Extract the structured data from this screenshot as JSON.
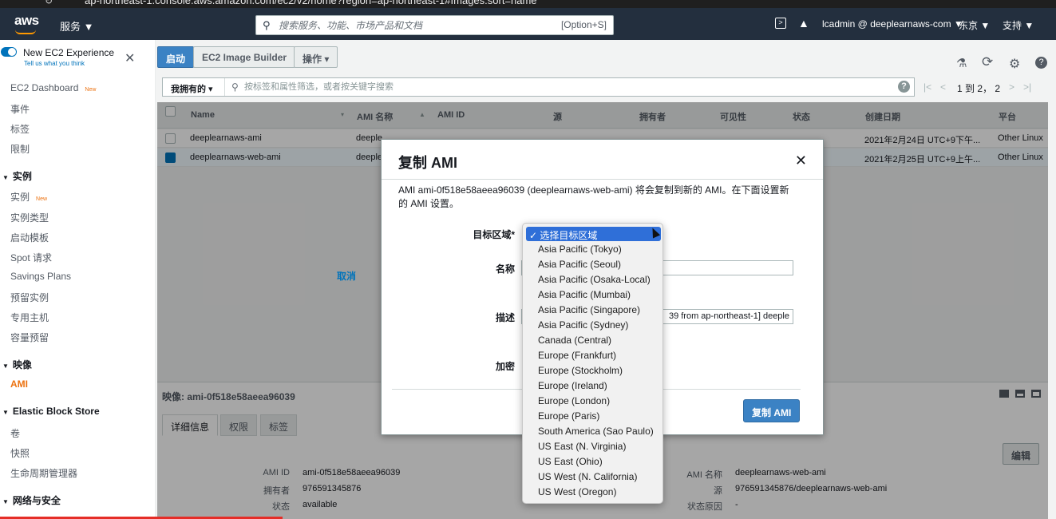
{
  "browser": {
    "url": "ap-northeast-1.console.aws.amazon.com/ec2/v2/home?region=ap-northeast-1#Images:sort=name"
  },
  "topnav": {
    "logo": "aws",
    "services": "服务 ▼",
    "search_placeholder": "搜索服务、功能、市场产品和文档",
    "search_hint": "[Option+S]",
    "account": "lcadmin @ deeplearnaws-com ▼",
    "region": "东京 ▼",
    "support": "支持 ▼"
  },
  "sidebar": {
    "new_experience": "New EC2 Experience",
    "new_experience_sub": "Tell us what you think",
    "items": [
      {
        "label": "EC2 Dashboard",
        "badge": "New"
      },
      {
        "label": "事件"
      },
      {
        "label": "标签"
      },
      {
        "label": "限制"
      }
    ],
    "sec_instances": "实例",
    "instances": [
      {
        "label": "实例",
        "badge": "New"
      },
      {
        "label": "实例类型"
      },
      {
        "label": "启动模板"
      },
      {
        "label": "Spot 请求"
      },
      {
        "label": "Savings Plans"
      },
      {
        "label": "预留实例"
      },
      {
        "label": "专用主机"
      },
      {
        "label": "容量预留"
      }
    ],
    "sec_images": "映像",
    "images": [
      {
        "label": "AMI"
      }
    ],
    "sec_ebs": "Elastic Block Store",
    "ebs": [
      {
        "label": "卷"
      },
      {
        "label": "快照"
      },
      {
        "label": "生命周期管理器"
      }
    ],
    "sec_network": "网络与安全"
  },
  "toolbar": {
    "launch": "启动",
    "image_builder": "EC2 Image Builder",
    "actions": "操作 ▾"
  },
  "filter": {
    "owned": "我拥有的 ▾",
    "placeholder": "按标签和属性筛选，或者按关键字搜索",
    "pager": "1 到 2， 2"
  },
  "table": {
    "columns": [
      "Name",
      "AMI 名称",
      "AMI ID",
      "源",
      "拥有者",
      "可见性",
      "状态",
      "创建日期",
      "平台"
    ],
    "rows": [
      {
        "name": "deeplearnaws-ami",
        "ami_name": "deeple",
        "date": "2021年2月24日 UTC+9下午...",
        "platform": "Other Linux",
        "selected": false
      },
      {
        "name": "deeplearnaws-web-ami",
        "ami_name": "deeple",
        "date": "2021年2月25日 UTC+9上午...",
        "platform": "Other Linux",
        "selected": true
      }
    ]
  },
  "detail": {
    "title": "映像: ami-0f518e58aeea96039",
    "tabs": [
      "详细信息",
      "权限",
      "标签"
    ],
    "edit": "编辑",
    "fields_left": [
      {
        "label": "AMI ID",
        "value": "ami-0f518e58aeea96039"
      },
      {
        "label": "拥有者",
        "value": "976591345876"
      },
      {
        "label": "状态",
        "value": "available"
      }
    ],
    "fields_right": [
      {
        "label": "AMI 名称",
        "value": "deeplearnaws-web-ami"
      },
      {
        "label": "源",
        "value": "976591345876/deeplearnaws-web-ami"
      },
      {
        "label": "状态原因",
        "value": "-"
      }
    ]
  },
  "modal": {
    "title": "复制 AMI",
    "close": "✕",
    "description": "AMI ami-0f518e58aeea96039 (deeplearnaws-web-ami) 将会复制到新的 AMI。在下面设置新的 AMI 设置。",
    "label_region": "目标区域*",
    "label_name": "名称",
    "label_desc": "描述",
    "desc_value": "39 from ap-northeast-1] deeple",
    "label_encrypt": "加密",
    "cancel": "取消",
    "copy": "复制 AMI"
  },
  "dropdown": {
    "selected": "✓ 选择目标区域",
    "options": [
      "Asia Pacific (Tokyo)",
      "Asia Pacific (Seoul)",
      "Asia Pacific (Osaka-Local)",
      "Asia Pacific (Mumbai)",
      "Asia Pacific (Singapore)",
      "Asia Pacific (Sydney)",
      "Canada (Central)",
      "Europe (Frankfurt)",
      "Europe (Stockholm)",
      "Europe (Ireland)",
      "Europe (London)",
      "Europe (Paris)",
      "South America (Sao Paulo)",
      "US East (N. Virginia)",
      "US East (Ohio)",
      "US West (N. California)",
      "US West (Oregon)"
    ]
  }
}
